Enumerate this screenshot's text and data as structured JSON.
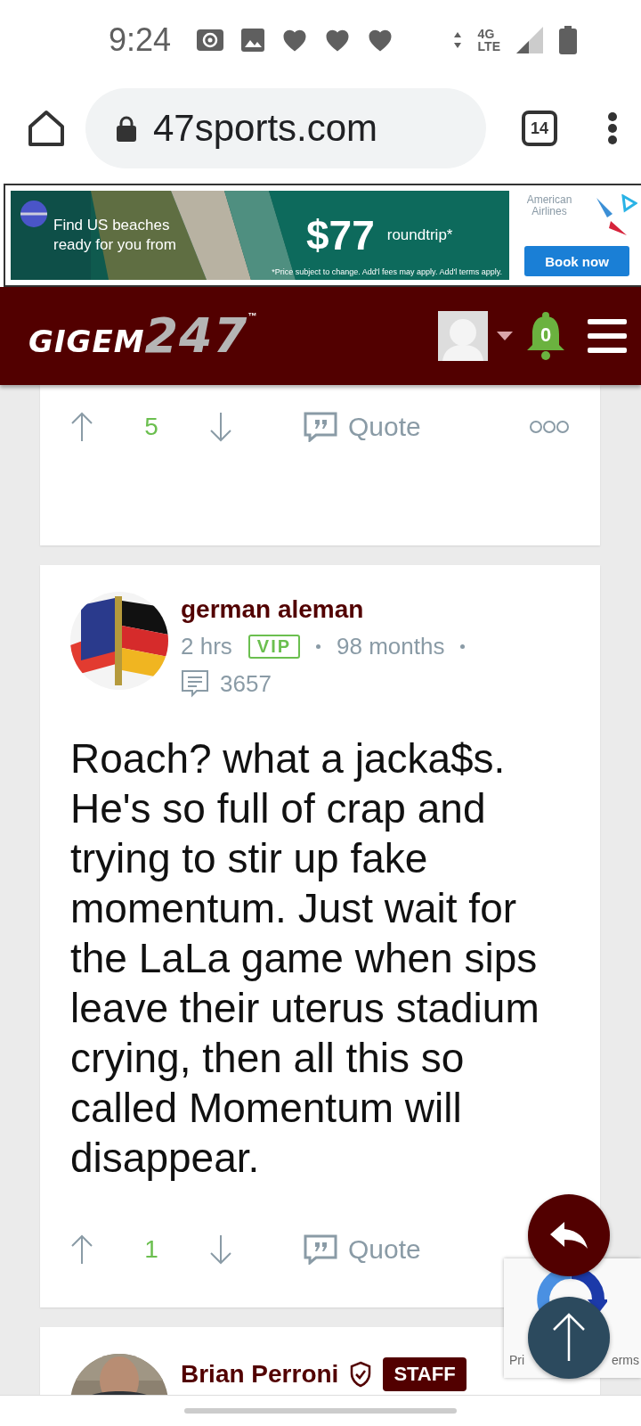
{
  "status_bar": {
    "time": "9:24",
    "network": "4G",
    "network_sub": "LTE"
  },
  "browser": {
    "url": "47sports.com",
    "tab_count": "14"
  },
  "ad": {
    "headline": "Find US beaches ready for you from",
    "price": "$77",
    "price_note": "roundtrip*",
    "disclaimer": "*Price subject to change. Add'l fees may apply. Add'l terms apply.",
    "brand": "American Airlines",
    "cta": "Book now"
  },
  "site_header": {
    "logo_main": "GIGEM",
    "logo_number": "247",
    "logo_mark": "™",
    "notifications": "0"
  },
  "posts": [
    {
      "votes": "5",
      "quote": "Quote",
      "has_more": true
    },
    {
      "author": "german aleman",
      "time": "2 hrs",
      "badge": "VIP",
      "tenure": "98 months",
      "post_count": "3657",
      "body": "Roach? what a jacka$s. He's so full of crap and trying to stir up fake momentum. Just wait for the LaLa game when sips leave their uterus stadium crying, then all this so called Momentum will disappear.",
      "votes": "1",
      "quote": "Quote",
      "has_more": false
    },
    {
      "author": "Brian Perroni",
      "verified": true,
      "role": "STAFF"
    }
  ],
  "recaptcha": {
    "left_text": "Pri",
    "right_text": "erms"
  }
}
